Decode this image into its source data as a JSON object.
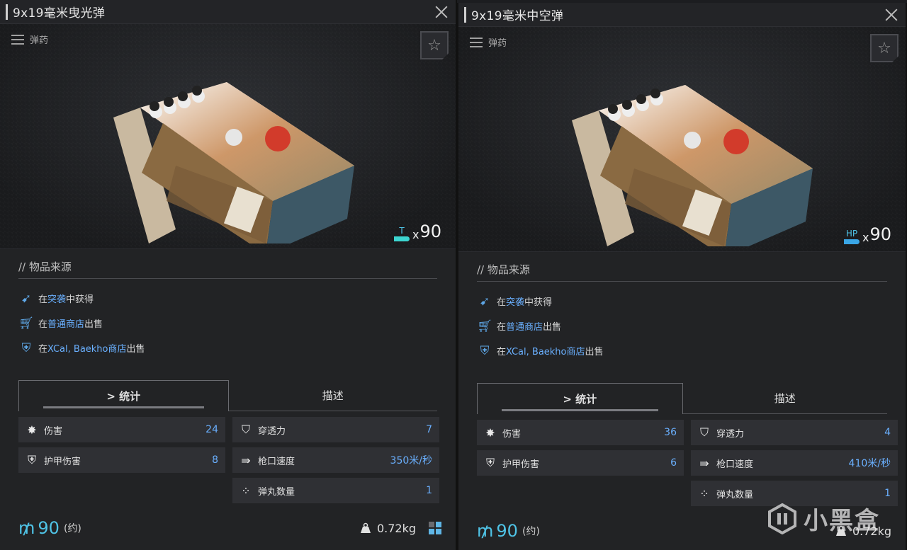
{
  "panels": [
    {
      "title": "9x19毫米曳光弹",
      "category": "弹药",
      "quantity_tag": "T",
      "quantity_x": "x",
      "quantity": "90",
      "source_title": "// 物品来源",
      "sources": [
        {
          "prefix": "在",
          "link": "突袭",
          "suffix": "中获得",
          "icon": "raid-icon"
        },
        {
          "prefix": "在",
          "link": "普通商店",
          "suffix": "出售",
          "icon": "cart-icon"
        },
        {
          "prefix": "在",
          "link": "XCal, Baekho商店",
          "suffix": "出售",
          "icon": "shield-star-icon"
        }
      ],
      "tabs": [
        "> 统计",
        "描述"
      ],
      "stats": [
        {
          "label": "伤害",
          "value": "24",
          "icon": "damage-icon"
        },
        {
          "label": "穿透力",
          "value": "7",
          "icon": "penetration-icon"
        },
        {
          "label": "护甲伤害",
          "value": "8",
          "icon": "armor-damage-icon"
        },
        {
          "label": "枪口速度",
          "value": "350米/秒",
          "icon": "velocity-icon"
        },
        {
          "label": "弹丸数量",
          "value": "1",
          "icon": "pellet-icon"
        }
      ],
      "price": "90",
      "price_note": "(约)",
      "weight": "0.72kg"
    },
    {
      "title": "9x19毫米中空弹",
      "category": "弹药",
      "quantity_tag": "HP",
      "quantity_x": "x",
      "quantity": "90",
      "source_title": "// 物品来源",
      "sources": [
        {
          "prefix": "在",
          "link": "突袭",
          "suffix": "中获得",
          "icon": "raid-icon"
        },
        {
          "prefix": "在",
          "link": "普通商店",
          "suffix": "出售",
          "icon": "cart-icon"
        },
        {
          "prefix": "在",
          "link": "XCal, Baekho商店",
          "suffix": "出售",
          "icon": "shield-star-icon"
        }
      ],
      "tabs": [
        "> 统计",
        "描述"
      ],
      "stats": [
        {
          "label": "伤害",
          "value": "36",
          "icon": "damage-icon"
        },
        {
          "label": "穿透力",
          "value": "4",
          "icon": "penetration-icon"
        },
        {
          "label": "护甲伤害",
          "value": "6",
          "icon": "armor-damage-icon"
        },
        {
          "label": "枪口速度",
          "value": "410米/秒",
          "icon": "velocity-icon"
        },
        {
          "label": "弹丸数量",
          "value": "1",
          "icon": "pellet-icon"
        }
      ],
      "price": "90",
      "price_note": "(约)",
      "weight": "0.72kg"
    }
  ],
  "watermark": "小黑盒",
  "colors": {
    "accent_blue": "#6ab0ff",
    "accent_cyan": "#4fc3e6",
    "panel_bg": "#222325"
  }
}
